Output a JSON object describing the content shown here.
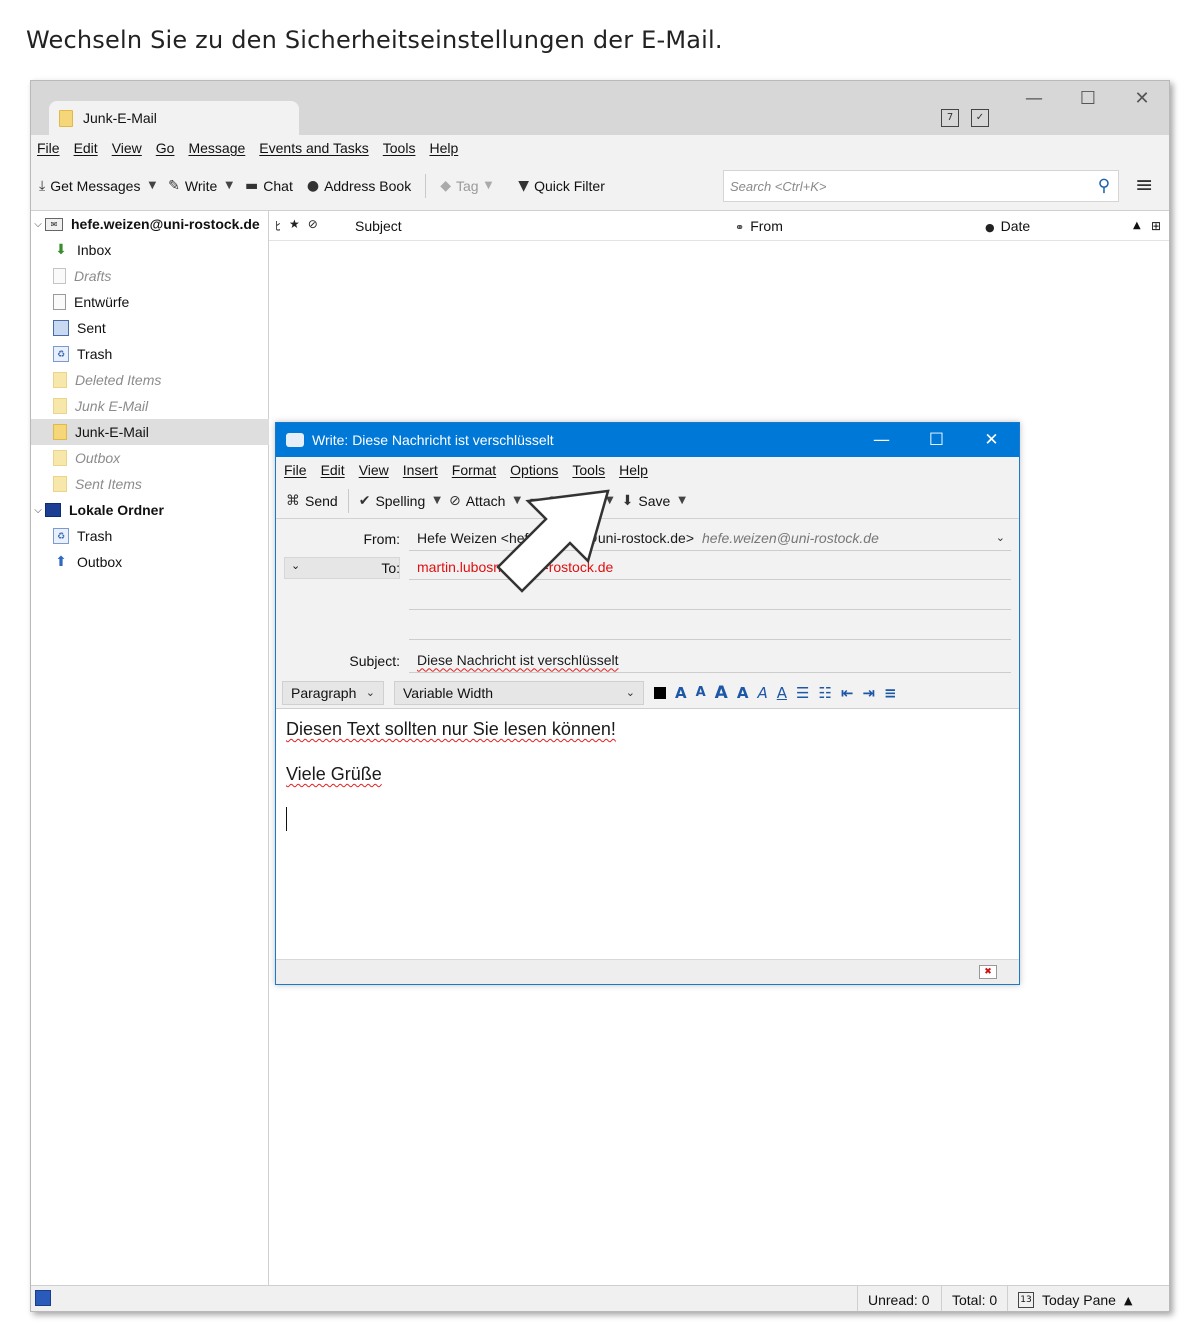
{
  "instruction": "Wechseln Sie zu den Sicherheitseinstellungen der E-Mail.",
  "main": {
    "tab_title": "Junk-E-Mail",
    "window_controls": {
      "minimize": "—",
      "maximize": "☐",
      "close": "✕"
    },
    "menu": [
      "File",
      "Edit",
      "View",
      "Go",
      "Message",
      "Events and Tasks",
      "Tools",
      "Help"
    ],
    "toolbar": {
      "get_messages": "Get Messages",
      "write": "Write",
      "chat": "Chat",
      "address_book": "Address Book",
      "tag": "Tag",
      "quick_filter": "Quick Filter"
    },
    "search": {
      "placeholder": "Search <Ctrl+K>"
    },
    "folders": [
      {
        "label": "hefe.weizen@uni-rostock.de",
        "type": "account"
      },
      {
        "label": "Inbox",
        "type": "inbox"
      },
      {
        "label": "Drafts",
        "type": "doc-dim"
      },
      {
        "label": "Entwürfe",
        "type": "doc"
      },
      {
        "label": "Sent",
        "type": "box"
      },
      {
        "label": "Trash",
        "type": "trash"
      },
      {
        "label": "Deleted Items",
        "type": "folder-dim"
      },
      {
        "label": "Junk E-Mail",
        "type": "folder-dim"
      },
      {
        "label": "Junk-E-Mail",
        "type": "folder-selected"
      },
      {
        "label": "Outbox",
        "type": "folder-dim"
      },
      {
        "label": "Sent Items",
        "type": "folder-dim"
      },
      {
        "label": "Lokale Ordner",
        "type": "local"
      },
      {
        "label": "Trash",
        "type": "trash"
      },
      {
        "label": "Outbox",
        "type": "outbox"
      }
    ],
    "columns": {
      "subject": "Subject",
      "from": "From",
      "date": "Date"
    },
    "status": {
      "unread": "Unread: 0",
      "total": "Total: 0",
      "today_pane": "Today Pane"
    }
  },
  "compose": {
    "title": "Write: Diese Nachricht ist verschlüsselt",
    "menu": [
      "File",
      "Edit",
      "View",
      "Insert",
      "Format",
      "Options",
      "Tools",
      "Help"
    ],
    "toolbar": {
      "send": "Send",
      "spelling": "Spelling",
      "attach": "Attach",
      "security": "Security",
      "save": "Save"
    },
    "from_label": "From:",
    "from_value": "Hefe Weizen <hefe.weizen@uni-rostock.de>",
    "from_identity": "hefe.weizen@uni-rostock.de",
    "to_label": "To:",
    "to_value": "martin.lubosnik@uni-rostock.de",
    "subject_label": "Subject:",
    "subject_value": "Diese Nachricht ist verschlüsselt",
    "paragraph_format": "Paragraph",
    "font": "Variable Width",
    "body": {
      "line1": "Diesen Text sollten nur Sie lesen können!",
      "line2": "Viele Grüße"
    }
  }
}
